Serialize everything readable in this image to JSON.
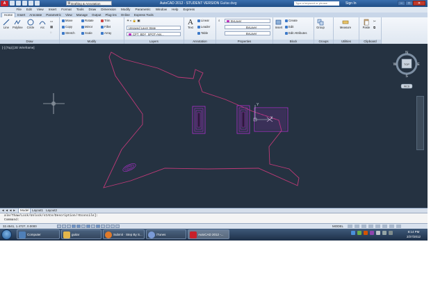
{
  "titlebar": {
    "app_letter": "A",
    "workspace": "Drafting & Annotation",
    "title": "AutoCAD 2012 - STUDENT VERSION",
    "filename": "Guitar.dwg",
    "search_placeholder": "Type a keyword or phrase",
    "sign_in": "Sign In",
    "minimize": "–",
    "maximize": "□",
    "close": "✕"
  },
  "menu": [
    "File",
    "Edit",
    "View",
    "Insert",
    "Format",
    "Tools",
    "Draw",
    "Dimension",
    "Modify",
    "Parametric",
    "Window",
    "Help",
    "Express"
  ],
  "ribbon_tabs": [
    "Home",
    "Insert",
    "Annotate",
    "Parametric",
    "View",
    "Manage",
    "Output",
    "Plug-ins",
    "Online",
    "Express Tools"
  ],
  "ribbon": {
    "draw": {
      "title": "Draw",
      "buttons": [
        "Line",
        "Polyline",
        "Circle",
        "Arc"
      ]
    },
    "modify": {
      "title": "Modify",
      "items": [
        "Move",
        "Rotate",
        "Trim",
        "Copy",
        "Mirror",
        "Fillet",
        "Stretch",
        "Scale",
        "Array"
      ]
    },
    "layers": {
      "title": "Layers",
      "layer_state": "Unsaved Layer State",
      "current_layer": "CPT_BDY_SPOT-Ass...",
      "color": "#bb33bb"
    },
    "annotation": {
      "title": "Annotation",
      "text": "Text",
      "items": [
        "Linear",
        "Leader",
        "Table"
      ]
    },
    "properties": {
      "title": "Properties",
      "bylayer_color": "ByLayer",
      "linetype": "ByLayer",
      "lineweight": "ByLayer"
    },
    "block": {
      "title": "Block",
      "insert": "Insert",
      "items": [
        "Create",
        "Edit",
        "Edit Attributes"
      ]
    },
    "groups": {
      "title": "Groups",
      "group": "Group"
    },
    "utilities": {
      "title": "Utilities",
      "measure": "Measure"
    },
    "clipboard": {
      "title": "Clipboard",
      "paste": "Paste"
    }
  },
  "drawing": {
    "viewport_label": "[-] [Top] [2D Wireframe]",
    "accent": "#c03a78",
    "pickup_color": "#b030d0",
    "viewcube": {
      "top": "TOP",
      "n": "N",
      "s": "S",
      "e": "E",
      "w": "W",
      "wcs": "WCS"
    },
    "ucs": {
      "x": "X",
      "y": "Y"
    }
  },
  "layout_tabs": [
    "Model",
    "Layout1",
    "Layout2"
  ],
  "command": {
    "line1": "ale/Thaw/Lock/Unlock/stAte/Description/rEconcile]:",
    "line2": "Command:"
  },
  "status": {
    "coords": "32.4541, 1.4727, 0.0000",
    "model": "MODEL"
  },
  "taskbar": {
    "buttons": [
      "Computer",
      "guitar",
      "Submit · Step By S...",
      "iTunes",
      "AutoCAD 2012 -..."
    ],
    "time": "8:14 PM",
    "date": "2/27/2012"
  }
}
